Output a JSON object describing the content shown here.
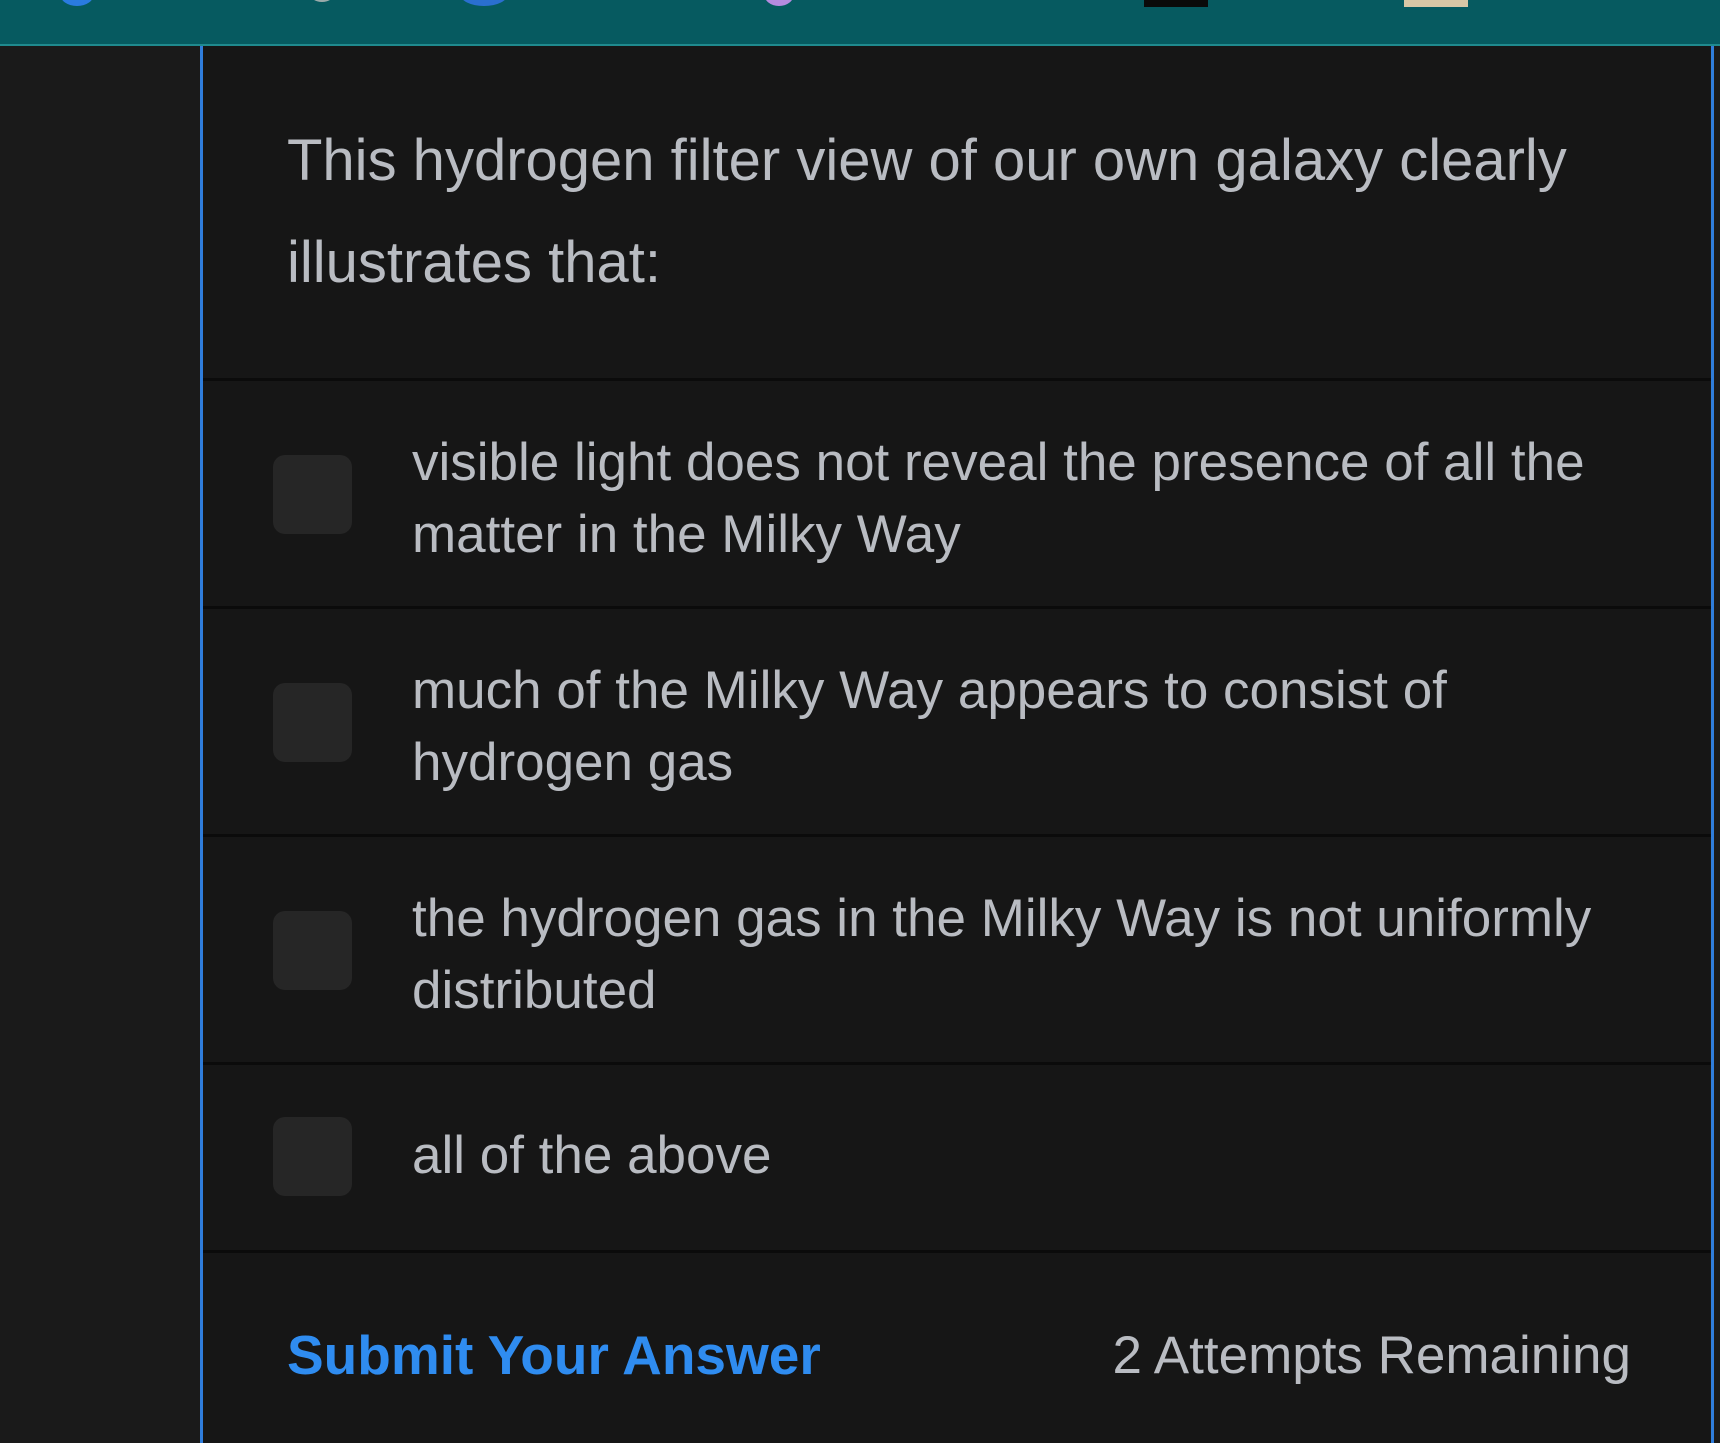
{
  "question": {
    "text": "This hydrogen filter view of our own galaxy clearly illustrates that:"
  },
  "options": [
    {
      "label": "visible light does not reveal the presence of all the matter in the Milky Way",
      "checked": false
    },
    {
      "label": "much of the Milky Way appears to consist of hydrogen gas",
      "checked": false
    },
    {
      "label": "the hydrogen gas in the Milky Way is not uniformly distributed",
      "checked": false
    },
    {
      "label": "all of the above",
      "checked": false
    }
  ],
  "footer": {
    "submit_label": "Submit Your Answer",
    "attempts_label": "2 Attempts Remaining"
  },
  "colors": {
    "accent": "#2f8cf0",
    "topbar": "#065a60",
    "panel_border": "#2f7ddb"
  }
}
